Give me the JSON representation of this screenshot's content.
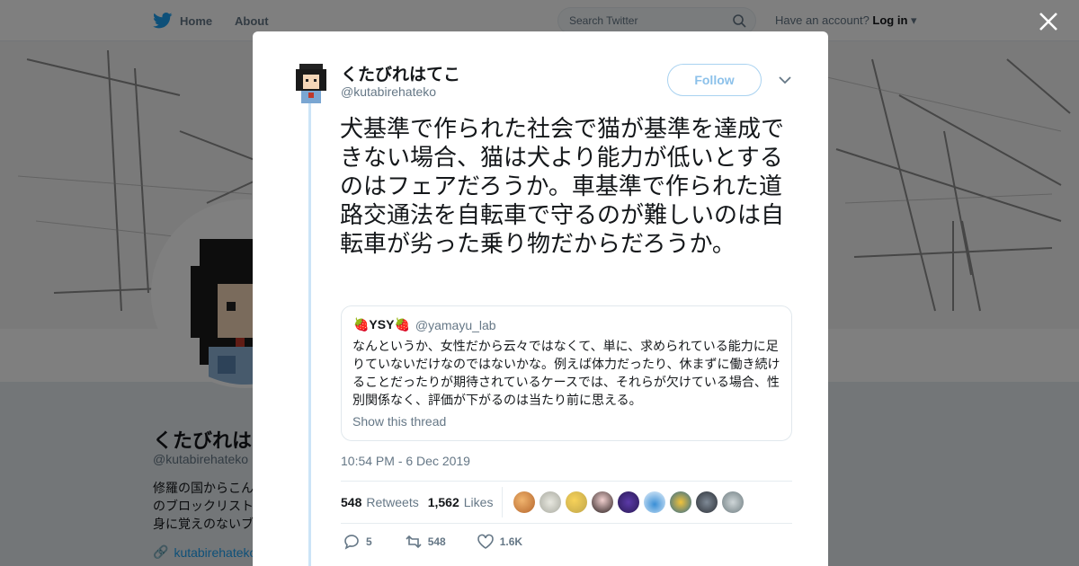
{
  "topbar": {
    "home_label": "Home",
    "about_label": "About",
    "search_placeholder": "Search Twitter",
    "account_prompt": "Have an account?",
    "login_label": "Log in"
  },
  "profile": {
    "name": "くたびれはてこ",
    "handle": "@kutabirehateko",
    "bio": "修羅の国からこん\nのブロックリスト\n身に覚えのないブ",
    "link": "kutabirehateko"
  },
  "tweet": {
    "author_name": "くたびれはてこ",
    "author_handle": "@kutabirehateko",
    "follow_label": "Follow",
    "text": "犬基準で作られた社会で猫が基準を達成できない場合、猫は犬より能力が低いとするのはフェアだろうか。車基準で作られた道路交通法を自転車で守るのが難しいのは自転車が劣った乗り物だからだろうか。",
    "timestamp": "10:54 PM - 6 Dec 2019",
    "retweet_count": "548",
    "retweet_label": "Retweets",
    "like_count": "1,562",
    "like_label": "Likes",
    "reply_action_count": "5",
    "retweet_action_count": "548",
    "like_action_count": "1.6K"
  },
  "quoted": {
    "name": "🍓YSY🍓",
    "handle": "@yamayu_lab",
    "text": "なんというか、女性だから云々ではなくて、単に、求められている能力に足りていないだけなのではないかな。例えば体力だったり、休まずに働き続けることだったりが期待されているケースでは、それらが欠けている場合、性別関係なく、評価が下がるのは当たり前に思える。",
    "show_thread": "Show this thread"
  },
  "colors": {
    "accent": "#1da1f2",
    "follow_border": "#a9d2f0",
    "thread_line": "#cce4f7",
    "muted": "#657786"
  },
  "icons": [
    "twitter-bird-icon",
    "search-icon",
    "caret-down-icon",
    "close-icon",
    "reply-icon",
    "retweet-icon",
    "heart-icon",
    "link-icon"
  ]
}
